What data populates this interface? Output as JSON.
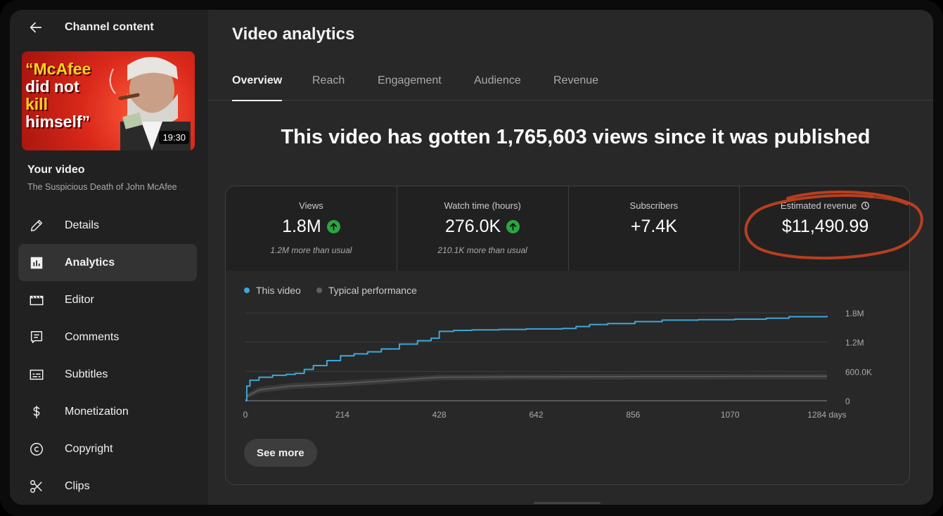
{
  "sidebar": {
    "back_label": "Channel content",
    "thumbnail": {
      "line1": "“McAfee",
      "line2": "did not",
      "line3": "kill",
      "line4": "himself”",
      "duration": "19:30"
    },
    "your_video_label": "Your video",
    "video_title": "The Suspicious Death of John McAfee",
    "items": [
      {
        "label": "Details",
        "icon": "pencil-icon",
        "active": false
      },
      {
        "label": "Analytics",
        "icon": "bar-chart-icon",
        "active": true
      },
      {
        "label": "Editor",
        "icon": "clapperboard-icon",
        "active": false
      },
      {
        "label": "Comments",
        "icon": "comment-icon",
        "active": false
      },
      {
        "label": "Subtitles",
        "icon": "subtitles-icon",
        "active": false
      },
      {
        "label": "Monetization",
        "icon": "dollar-icon",
        "active": false
      },
      {
        "label": "Copyright",
        "icon": "copyright-icon",
        "active": false
      },
      {
        "label": "Clips",
        "icon": "scissors-icon",
        "active": false
      }
    ]
  },
  "main": {
    "title": "Video analytics",
    "tabs": [
      {
        "label": "Overview",
        "active": true
      },
      {
        "label": "Reach",
        "active": false
      },
      {
        "label": "Engagement",
        "active": false
      },
      {
        "label": "Audience",
        "active": false
      },
      {
        "label": "Revenue",
        "active": false
      }
    ],
    "headline": "This video has gotten 1,765,603 views since it was published",
    "metrics": [
      {
        "label": "Views",
        "value": "1.8M",
        "trend": "up",
        "note": "1.2M more than usual"
      },
      {
        "label": "Watch time (hours)",
        "value": "276.0K",
        "trend": "up",
        "note": "210.1K more than usual"
      },
      {
        "label": "Subscribers",
        "value": "+7.4K",
        "trend": "",
        "note": ""
      },
      {
        "label": "Estimated revenue",
        "value": "$11,490.99",
        "trend": "",
        "note": "",
        "icon": "clock-icon"
      }
    ],
    "see_more_label": "See more"
  },
  "colors": {
    "this_video": "#3ea6d8",
    "typical": "#5f5f5f",
    "up_trend": "#2ba640",
    "annotation": "#c8431f"
  },
  "chart_data": {
    "type": "line",
    "legend": [
      "This video",
      "Typical performance"
    ],
    "x_tick_labels": [
      "0",
      "214",
      "428",
      "642",
      "856",
      "1070",
      "1284 days"
    ],
    "y_tick_labels": [
      "1.8M",
      "1.2M",
      "600.0K",
      "0"
    ],
    "xlim": [
      0,
      1284
    ],
    "ylim": [
      0,
      1800000
    ],
    "series": [
      {
        "name": "This video",
        "x": [
          0,
          3,
          10,
          30,
          60,
          90,
          110,
          130,
          150,
          180,
          210,
          240,
          270,
          300,
          340,
          380,
          410,
          428,
          460,
          500,
          560,
          620,
          700,
          730,
          760,
          800,
          860,
          920,
          1000,
          1080,
          1150,
          1200,
          1284
        ],
        "y": [
          0,
          300000,
          420000,
          480000,
          520000,
          540000,
          560000,
          640000,
          720000,
          820000,
          920000,
          960000,
          1000000,
          1060000,
          1160000,
          1230000,
          1280000,
          1420000,
          1440000,
          1450000,
          1460000,
          1470000,
          1480000,
          1520000,
          1560000,
          1580000,
          1620000,
          1650000,
          1660000,
          1670000,
          1690000,
          1720000,
          1740000
        ]
      },
      {
        "name": "Typical performance",
        "x": [
          0,
          5,
          30,
          100,
          214,
          428,
          642,
          856,
          1070,
          1284
        ],
        "y": [
          0,
          100000,
          220000,
          300000,
          350000,
          480000,
          490000,
          495000,
          498000,
          500000
        ],
        "y_low": [
          0,
          50000,
          160000,
          240000,
          290000,
          420000,
          430000,
          435000,
          438000,
          440000
        ],
        "y_high": [
          0,
          150000,
          280000,
          360000,
          410000,
          530000,
          540000,
          545000,
          548000,
          550000
        ]
      }
    ],
    "grid": true
  }
}
